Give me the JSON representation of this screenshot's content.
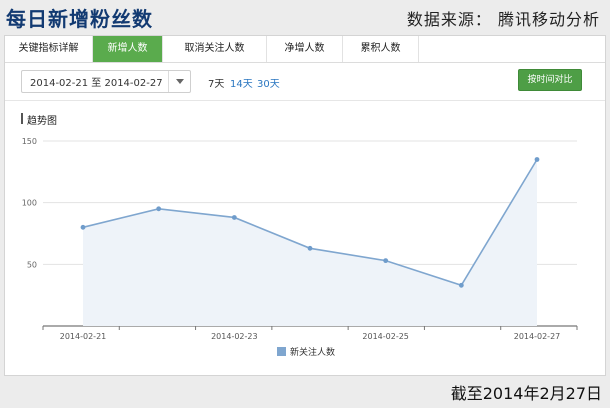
{
  "banner": {
    "title": "每日新增粉丝数",
    "source": "数据来源： 腾讯移动分析"
  },
  "tabs": [
    {
      "label": "关键指标详解",
      "active": false
    },
    {
      "label": "新增人数",
      "active": true
    },
    {
      "label": "取消关注人数",
      "active": false
    },
    {
      "label": "净增人数",
      "active": false
    },
    {
      "label": "累积人数",
      "active": false
    }
  ],
  "toolbar": {
    "date_range": "2014-02-21 至 2014-02-27",
    "ranges": [
      "7天",
      "14天",
      "30天"
    ],
    "compare_button": "按时间对比"
  },
  "chart_title": "趋势图",
  "chart_data": {
    "type": "area",
    "x": [
      "2014-02-21",
      "2014-02-22",
      "2014-02-23",
      "2014-02-24",
      "2014-02-25",
      "2014-02-26",
      "2014-02-27"
    ],
    "x_tick_labels": [
      "2014-02-21",
      "2014-02-23",
      "2014-02-25",
      "2014-02-27"
    ],
    "series": [
      {
        "name": "新关注人数",
        "values": [
          80,
          95,
          88,
          63,
          53,
          33,
          135
        ]
      }
    ],
    "ylim": [
      0,
      150
    ],
    "y_ticks": [
      50,
      100,
      150
    ],
    "grid": true,
    "legend_position": "bottom-center",
    "line_color": "#7fa6cf",
    "fill_color": "#eef3f9",
    "point_color": "#6f9ccb"
  },
  "footer_note": "截至2014年2月27日",
  "colors": {
    "banner_title": "#123a72",
    "tab_active": "#5aab4d",
    "button": "#4e9e46",
    "link": "#2a76c0"
  }
}
